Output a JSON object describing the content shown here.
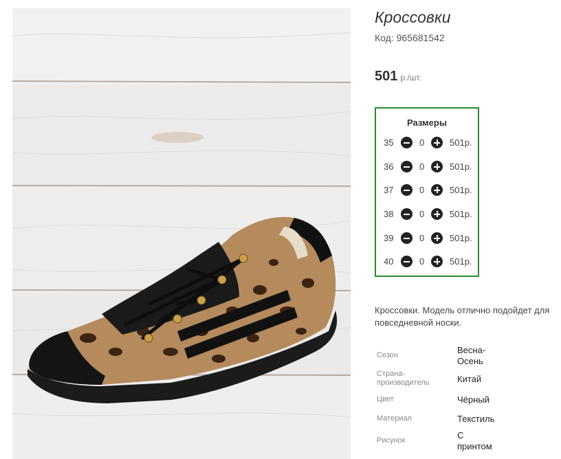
{
  "product": {
    "title": "Кроссовки",
    "code": "Код: 965681542",
    "price": "501",
    "price_unit": "р./шт."
  },
  "sizes": {
    "title": "Размеры",
    "rows": [
      {
        "size": "35",
        "qty": "0",
        "price": "501р."
      },
      {
        "size": "36",
        "qty": "0",
        "price": "501р."
      },
      {
        "size": "37",
        "qty": "0",
        "price": "501р."
      },
      {
        "size": "38",
        "qty": "0",
        "price": "501р."
      },
      {
        "size": "39",
        "qty": "0",
        "price": "501р."
      },
      {
        "size": "40",
        "qty": "0",
        "price": "501р."
      }
    ]
  },
  "description": "Кроссовки. Модель отлично подойдет для повседневной носки.",
  "attributes": [
    {
      "label": "Сезон",
      "value": "Весна-Осень"
    },
    {
      "label": "Страна-производитель",
      "value": "Китай"
    },
    {
      "label": "Цвет",
      "value": "Чёрный"
    },
    {
      "label": "Материал",
      "value": "Текстиль"
    },
    {
      "label": "Рисунок",
      "value": "С принтом"
    }
  ],
  "colors": {
    "accent_border": "#2a8a2a",
    "photo_bg": "#ececec"
  },
  "icons": {
    "minus": "minus-circle-icon",
    "plus": "plus-circle-icon"
  }
}
